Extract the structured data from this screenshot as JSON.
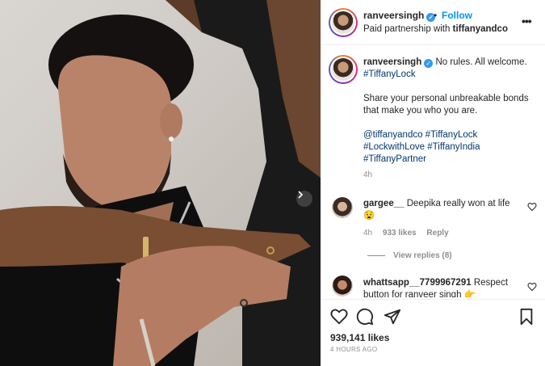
{
  "post": {
    "username": "ranveersingh",
    "separator": "•",
    "follow_label": "Follow",
    "partnership_prefix": "Paid partnership with",
    "partner": "tiffanyandco",
    "more_label": "•••"
  },
  "caption": {
    "username": "ranveersingh",
    "line1": "No rules. All welcome.",
    "tag1": "#TiffanyLock",
    "body": "Share your personal unbreakable bonds that make you who you are.",
    "tags_line1": "@tiffanyandco #TiffanyLock",
    "tags_line2": "#LockwithLove #TiffanyIndia",
    "tags_line3": "#TiffanyPartner",
    "time": "4h"
  },
  "comments": [
    {
      "username": "gargee__",
      "text": "Deepika really won at life",
      "emoji": "😧",
      "time": "4h",
      "likes": "933 likes",
      "reply_label": "Reply",
      "view_replies": "View replies (8)"
    },
    {
      "username": "whattsapp__7799967291",
      "text_line1": "Respect",
      "text_line2": "button for ranveer singh 👉"
    }
  ],
  "footer": {
    "likes": "939,141 likes",
    "ago": "4 HOURS AGO"
  },
  "icons": {
    "verified": "verified-badge-icon",
    "next": "chevron-right-icon",
    "like": "heart-icon",
    "comment": "speech-bubble-icon",
    "share": "paper-plane-icon",
    "save": "bookmark-icon"
  },
  "colors": {
    "link": "#00376b",
    "follow": "#0095f6",
    "verified": "#3897f0",
    "muted": "#8e8e8e"
  }
}
